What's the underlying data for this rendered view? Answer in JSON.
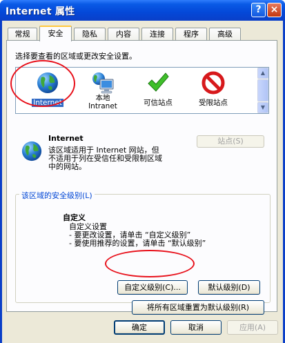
{
  "window": {
    "title": "Internet 属性",
    "help_label": "?",
    "close_label": "×"
  },
  "tabs": [
    {
      "label": "常规"
    },
    {
      "label": "安全"
    },
    {
      "label": "隐私"
    },
    {
      "label": "内容"
    },
    {
      "label": "连接"
    },
    {
      "label": "程序"
    },
    {
      "label": "高级"
    }
  ],
  "active_tab": "安全",
  "security": {
    "instruction": "选择要查看的区域或更改安全设置。",
    "zones": [
      {
        "line1": "Internet",
        "line2": "",
        "icon": "globe-icon"
      },
      {
        "line1": "本地",
        "line2": "Intranet",
        "icon": "computer-icon"
      },
      {
        "line1": "可信站点",
        "line2": "",
        "icon": "checkmark-icon"
      },
      {
        "line1": "受限站点",
        "line2": "",
        "icon": "forbidden-icon"
      }
    ],
    "selected_zone": "Internet",
    "zone_name": "Internet",
    "zone_description": [
      "该区域适用于 Internet 网站，但",
      "不适用于列在受信任和受限制区域",
      "中的网站。"
    ],
    "sites_button": "站点(S)",
    "level_group_title": "该区域的安全级别(L)",
    "level_title": "自定义",
    "level_lines": [
      "自定义设置",
      "- 要更改设置，请单击 “自定义级别”",
      "- 要使用推荐的设置，请单击 “默认级别”"
    ],
    "custom_level_button": "自定义级别(C)...",
    "default_level_button": "默认级别(D)",
    "reset_all_button": "将所有区域重置为默认级别(R)"
  },
  "footer": {
    "ok_button": "确定",
    "cancel_button": "取消",
    "apply_button": "应用(A)"
  },
  "colors": {
    "titlebar": "#0a5ae6",
    "highlight": "#316ac5",
    "annotation_ring": "#e8101a"
  }
}
